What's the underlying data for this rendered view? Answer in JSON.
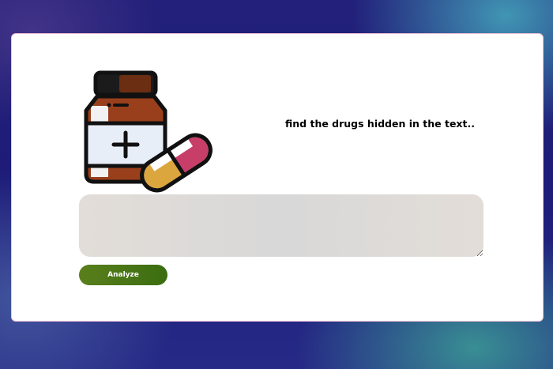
{
  "main": {
    "headline": "find the drugs hidden in the text..",
    "input": {
      "value": "",
      "placeholder": ""
    },
    "analyze_label": "Analyze"
  },
  "icons": {
    "illustration": "medicine-bottle-and-capsule-icon"
  },
  "colors": {
    "button": "#4a7616",
    "input_background": "#dcd8d4",
    "bottle_body": "#9a3f1c",
    "bottle_label": "#e8eef7",
    "capsule_pink": "#c73e68",
    "capsule_yellow": "#dca63e"
  }
}
